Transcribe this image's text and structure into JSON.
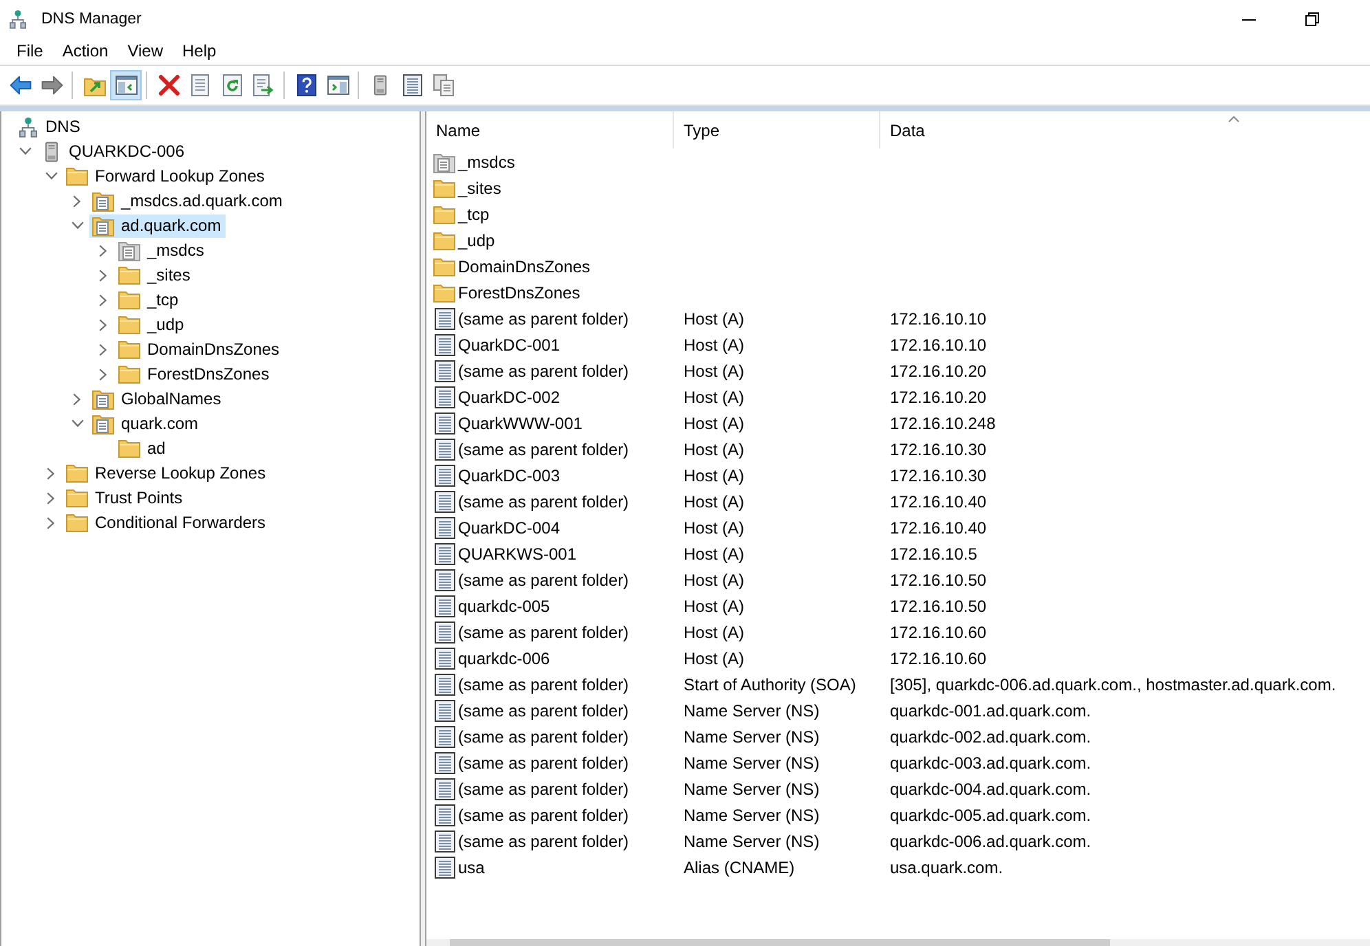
{
  "window": {
    "title": "DNS Manager"
  },
  "menu": [
    {
      "label": "File"
    },
    {
      "label": "Action"
    },
    {
      "label": "View"
    },
    {
      "label": "Help"
    }
  ],
  "toolbar": [
    {
      "kind": "back",
      "disabled": false,
      "pressed": false
    },
    {
      "kind": "forward",
      "disabled": true,
      "pressed": false
    },
    {
      "kind": "separator"
    },
    {
      "kind": "up",
      "pressed": false
    },
    {
      "kind": "consoletree",
      "pressed": true
    },
    {
      "kind": "separator"
    },
    {
      "kind": "delete",
      "pressed": false
    },
    {
      "kind": "properties",
      "pressed": false
    },
    {
      "kind": "refresh",
      "pressed": false
    },
    {
      "kind": "export",
      "pressed": false
    },
    {
      "kind": "separator"
    },
    {
      "kind": "help",
      "pressed": false
    },
    {
      "kind": "actionpane",
      "pressed": false
    },
    {
      "kind": "separator"
    },
    {
      "kind": "server",
      "pressed": false
    },
    {
      "kind": "list",
      "pressed": false
    },
    {
      "kind": "copy",
      "pressed": false
    }
  ],
  "tree": [
    {
      "label": "DNS",
      "kind": "dns",
      "selected": false,
      "children": [
        {
          "label": "QUARKDC-006",
          "kind": "server",
          "expanded": true,
          "selected": false,
          "children": [
            {
              "label": "Forward Lookup Zones",
              "kind": "folder",
              "expanded": true,
              "selected": false,
              "children": [
                {
                  "label": "_msdcs.ad.quark.com",
                  "kind": "zone",
                  "expanded": false,
                  "selected": false
                },
                {
                  "label": "ad.quark.com",
                  "kind": "zone",
                  "expanded": true,
                  "selected": true,
                  "children": [
                    {
                      "label": "_msdcs",
                      "kind": "delegation",
                      "expanded": false,
                      "selected": false
                    },
                    {
                      "label": "_sites",
                      "kind": "folder",
                      "expanded": false,
                      "selected": false
                    },
                    {
                      "label": "_tcp",
                      "kind": "folder",
                      "expanded": false,
                      "selected": false
                    },
                    {
                      "label": "_udp",
                      "kind": "folder",
                      "expanded": false,
                      "selected": false
                    },
                    {
                      "label": "DomainDnsZones",
                      "kind": "folder",
                      "expanded": false,
                      "selected": false
                    },
                    {
                      "label": "ForestDnsZones",
                      "kind": "folder",
                      "expanded": false,
                      "selected": false
                    }
                  ]
                },
                {
                  "label": "GlobalNames",
                  "kind": "zone",
                  "expanded": false,
                  "selected": false
                },
                {
                  "label": "quark.com",
                  "kind": "zone",
                  "expanded": true,
                  "selected": false,
                  "children": [
                    {
                      "label": "ad",
                      "kind": "folder",
                      "selected": false
                    }
                  ]
                }
              ]
            },
            {
              "label": "Reverse Lookup Zones",
              "kind": "folder",
              "expanded": false,
              "selected": false
            },
            {
              "label": "Trust Points",
              "kind": "folder",
              "expanded": false,
              "selected": false
            },
            {
              "label": "Conditional Forwarders",
              "kind": "folder",
              "expanded": false,
              "selected": false
            }
          ]
        }
      ]
    }
  ],
  "list": {
    "columns": [
      {
        "label": "Name",
        "sorted": false
      },
      {
        "label": "Type",
        "sorted": false
      },
      {
        "label": "Data",
        "sorted": true
      }
    ],
    "rows": [
      {
        "kind": "delegation",
        "name": "_msdcs",
        "selected": false
      },
      {
        "kind": "folder",
        "name": "_sites",
        "selected": false
      },
      {
        "kind": "folder",
        "name": "_tcp",
        "selected": false
      },
      {
        "kind": "folder",
        "name": "_udp",
        "selected": false
      },
      {
        "kind": "folder",
        "name": "DomainDnsZones",
        "selected": false
      },
      {
        "kind": "folder",
        "name": "ForestDnsZones",
        "selected": false
      },
      {
        "kind": "record",
        "name": "(same as parent folder)",
        "type": "Host (A)",
        "data": "172.16.10.10",
        "selected": false
      },
      {
        "kind": "record",
        "name": "QuarkDC-001",
        "type": "Host (A)",
        "data": "172.16.10.10",
        "selected": false
      },
      {
        "kind": "record",
        "name": "(same as parent folder)",
        "type": "Host (A)",
        "data": "172.16.10.20",
        "selected": false
      },
      {
        "kind": "record",
        "name": "QuarkDC-002",
        "type": "Host (A)",
        "data": "172.16.10.20",
        "selected": false
      },
      {
        "kind": "record",
        "name": "QuarkWWW-001",
        "type": "Host (A)",
        "data": "172.16.10.248",
        "selected": false
      },
      {
        "kind": "record",
        "name": "(same as parent folder)",
        "type": "Host (A)",
        "data": "172.16.10.30",
        "selected": false
      },
      {
        "kind": "record",
        "name": "QuarkDC-003",
        "type": "Host (A)",
        "data": "172.16.10.30",
        "selected": false
      },
      {
        "kind": "record",
        "name": "(same as parent folder)",
        "type": "Host (A)",
        "data": "172.16.10.40",
        "selected": false
      },
      {
        "kind": "record",
        "name": "QuarkDC-004",
        "type": "Host (A)",
        "data": "172.16.10.40",
        "selected": false
      },
      {
        "kind": "record",
        "name": "QUARKWS-001",
        "type": "Host (A)",
        "data": "172.16.10.5",
        "selected": false
      },
      {
        "kind": "record",
        "name": "(same as parent folder)",
        "type": "Host (A)",
        "data": "172.16.10.50",
        "selected": false
      },
      {
        "kind": "record",
        "name": "quarkdc-005",
        "type": "Host (A)",
        "data": "172.16.10.50",
        "selected": false
      },
      {
        "kind": "record",
        "name": "(same as parent folder)",
        "type": "Host (A)",
        "data": "172.16.10.60",
        "selected": false
      },
      {
        "kind": "record",
        "name": "quarkdc-006",
        "type": "Host (A)",
        "data": "172.16.10.60",
        "selected": false
      },
      {
        "kind": "record",
        "name": "(same as parent folder)",
        "type": "Start of Authority (SOA)",
        "data": "[305], quarkdc-006.ad.quark.com., hostmaster.ad.quark.com.",
        "selected": false
      },
      {
        "kind": "record",
        "name": "(same as parent folder)",
        "type": "Name Server (NS)",
        "data": "quarkdc-001.ad.quark.com.",
        "selected": false
      },
      {
        "kind": "record",
        "name": "(same as parent folder)",
        "type": "Name Server (NS)",
        "data": "quarkdc-002.ad.quark.com.",
        "selected": false
      },
      {
        "kind": "record",
        "name": "(same as parent folder)",
        "type": "Name Server (NS)",
        "data": "quarkdc-003.ad.quark.com.",
        "selected": false
      },
      {
        "kind": "record",
        "name": "(same as parent folder)",
        "type": "Name Server (NS)",
        "data": "quarkdc-004.ad.quark.com.",
        "selected": false
      },
      {
        "kind": "record",
        "name": "(same as parent folder)",
        "type": "Name Server (NS)",
        "data": "quarkdc-005.ad.quark.com.",
        "selected": false
      },
      {
        "kind": "record",
        "name": "(same as parent folder)",
        "type": "Name Server (NS)",
        "data": "quarkdc-006.ad.quark.com.",
        "selected": false
      },
      {
        "kind": "record",
        "name": "usa",
        "type": "Alias (CNAME)",
        "data": "usa.quark.com.",
        "selected": false
      }
    ]
  }
}
